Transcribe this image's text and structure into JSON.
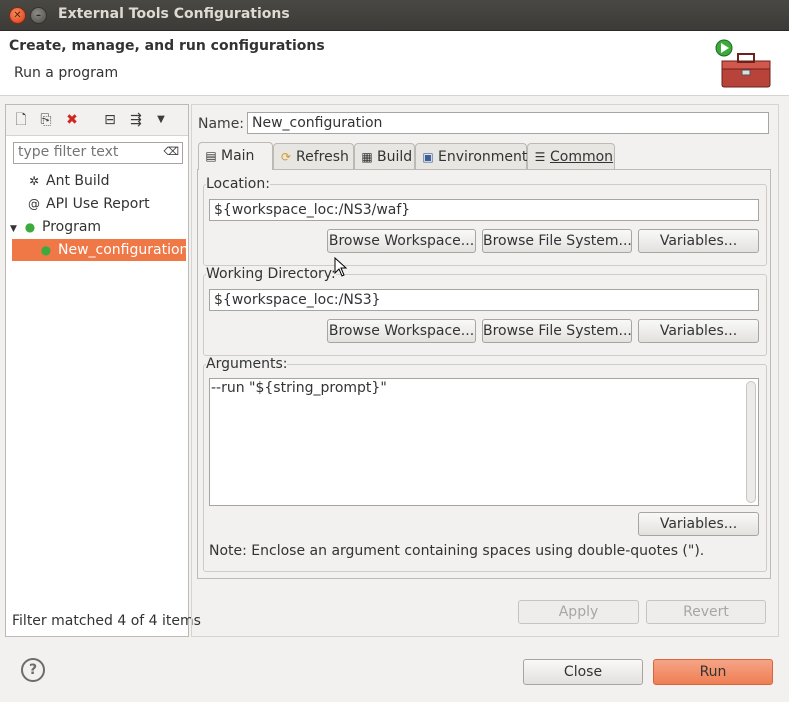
{
  "window": {
    "title": "External Tools Configurations"
  },
  "header": {
    "title": "Create, manage, and run configurations",
    "subtitle": "Run a program"
  },
  "left": {
    "filter_placeholder": "type filter text",
    "tree": [
      {
        "label": "Ant Build",
        "icon": "ant-icon"
      },
      {
        "label": "API Use Report",
        "icon": "api-report-icon"
      },
      {
        "label": "Program",
        "icon": "program-icon"
      },
      {
        "label": "New_configuration",
        "icon": "config-icon"
      }
    ],
    "status": "Filter matched 4 of 4 items"
  },
  "config": {
    "name_label": "Name:",
    "name_value": "New_configuration",
    "tabs": [
      "Main",
      "Refresh",
      "Build",
      "Environment",
      "Common"
    ],
    "location_label": "Location:",
    "location_value": "${workspace_loc:/NS3/waf}",
    "workdir_label": "Working Directory:",
    "workdir_value": "${workspace_loc:/NS3}",
    "browse_workspace": "Browse Workspace...",
    "browse_filesystem": "Browse File System...",
    "variables": "Variables...",
    "arguments_label": "Arguments:",
    "arguments_value": "--run \"${string_prompt}\"",
    "note": "Note: Enclose an argument containing spaces using double-quotes (\")."
  },
  "actions": {
    "apply": "Apply",
    "revert": "Revert",
    "close": "Close",
    "run": "Run"
  },
  "colors": {
    "selection": "#f07746",
    "run_button": "#ef7f55"
  }
}
